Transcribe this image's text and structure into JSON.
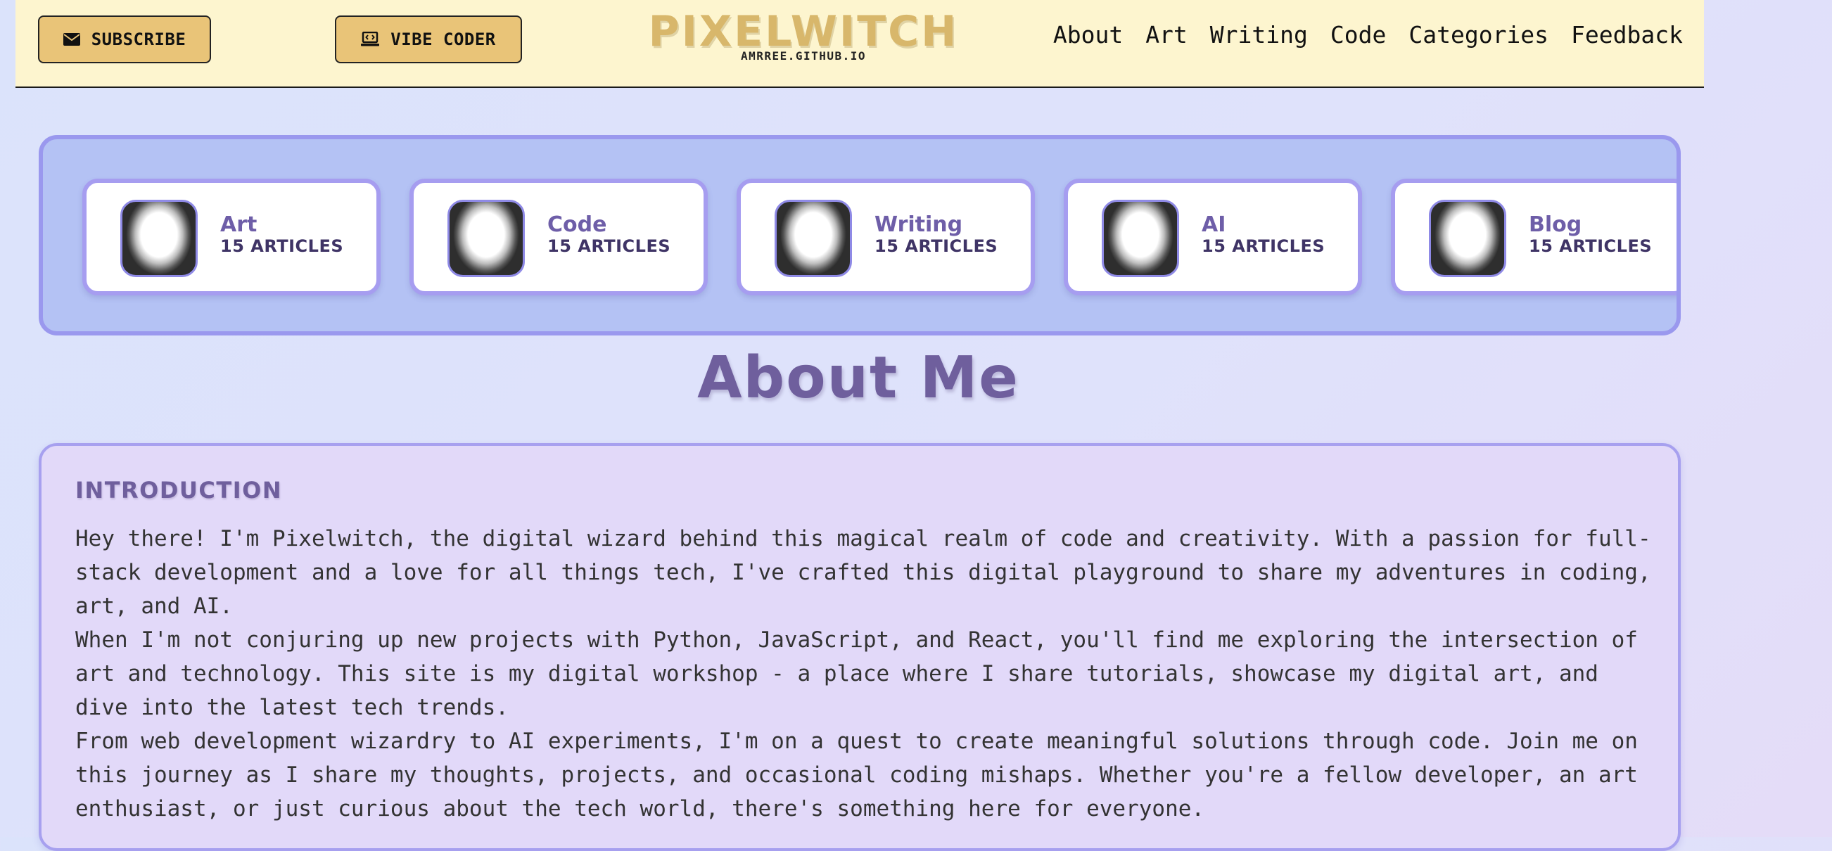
{
  "header": {
    "subscribe_label": "SUBSCRIBE",
    "vibe_coder_label": "VIBE CODER",
    "logo_title": "PIXELWITCH",
    "logo_subtitle": "AMRREE.GITHUB.IO",
    "nav": [
      "About",
      "Art",
      "Writing",
      "Code",
      "Categories",
      "Feedback"
    ]
  },
  "categories": [
    {
      "name": "Art",
      "count": "15 ARTICLES"
    },
    {
      "name": "Code",
      "count": "15 ARTICLES"
    },
    {
      "name": "Writing",
      "count": "15 ARTICLES"
    },
    {
      "name": "AI",
      "count": "15 ARTICLES"
    },
    {
      "name": "Blog",
      "count": "15 ARTICLES"
    }
  ],
  "page": {
    "title": "About Me"
  },
  "about": {
    "heading": "INTRODUCTION",
    "paragraphs": [
      "Hey there! I'm Pixelwitch, the digital wizard behind this magical realm of code and creativity. With a passion for full-stack development and a love for all things tech, I've crafted this digital playground to share my adventures in coding, art, and AI.",
      "When I'm not conjuring up new projects with Python, JavaScript, and React, you'll find me exploring the intersection of art and technology. This site is my digital workshop - a place where I share tutorials, showcase my digital art, and dive into the latest tech trends.",
      "From web development wizardry to AI experiments, I'm on a quest to create meaningful solutions through code. Join me on this journey as I share my thoughts, projects, and occasional coding mishaps. Whether you're a fellow developer, an art enthusiast, or just curious about the tech world, there's something here for everyone."
    ]
  },
  "colors": {
    "header_bg": "#fdf5cf",
    "button_bg": "#e9c478",
    "logo": "#d8b76b",
    "panel_bg": "#b4c2f4",
    "panel_border": "#9a98ee",
    "title": "#6f5f9d",
    "about_bg": "#e2d9f9"
  },
  "icons": {
    "subscribe": "envelope-icon",
    "vibe_coder": "laptop-code-icon",
    "category_avatar": "witch-avatar-icon"
  }
}
